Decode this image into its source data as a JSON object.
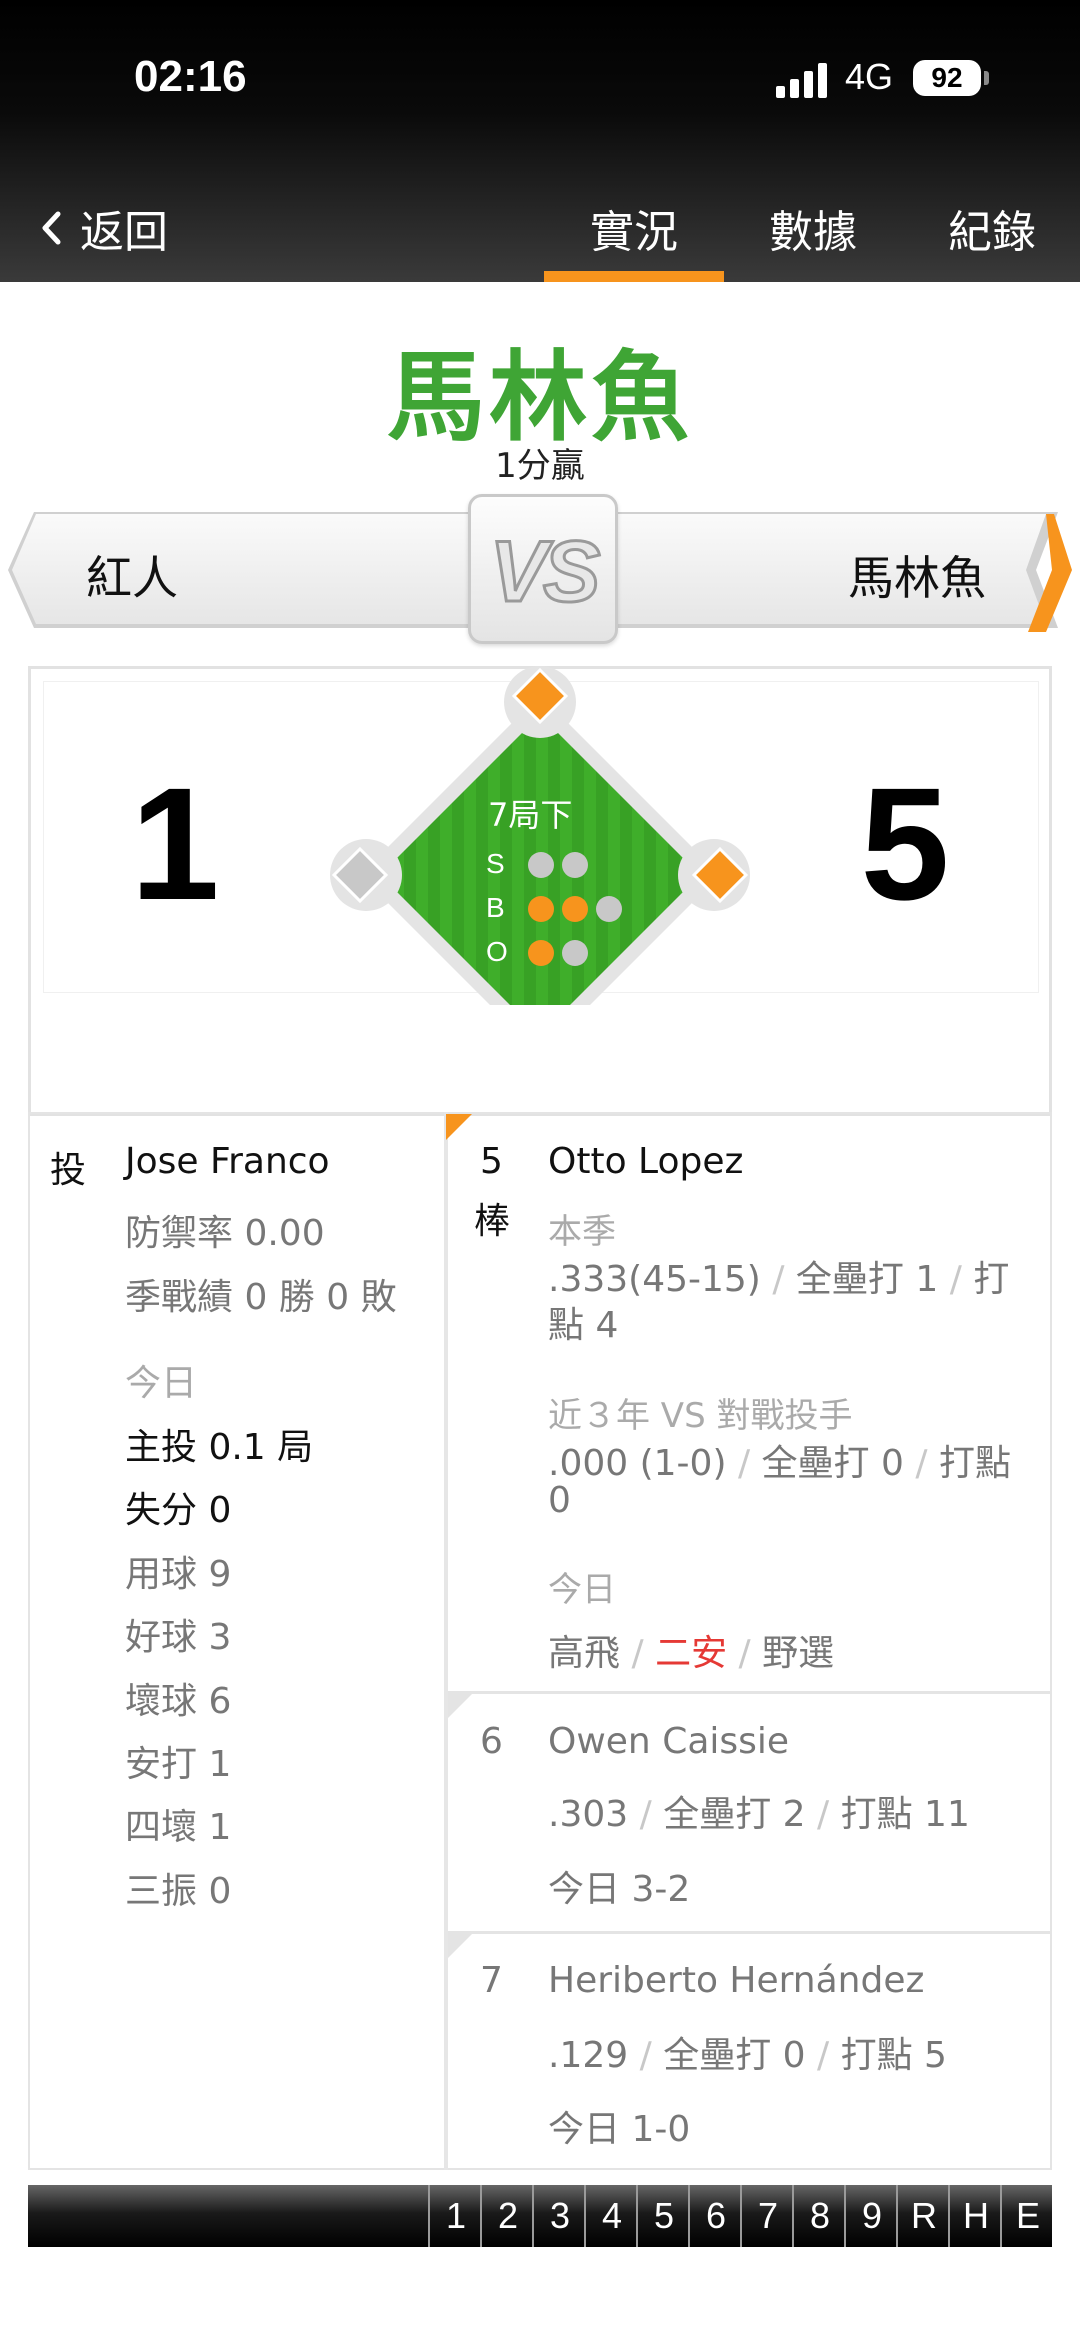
{
  "status_bar": {
    "time": "02:16",
    "network": "4G",
    "battery": "92"
  },
  "nav": {
    "back_label": "返回",
    "tabs": [
      {
        "label": "實況",
        "active": true
      },
      {
        "label": "數據",
        "active": false
      },
      {
        "label": "紀錄",
        "active": false
      }
    ]
  },
  "result": {
    "winner": "馬林魚",
    "margin": "1分贏"
  },
  "matchup": {
    "away_team": "紅人",
    "home_team": "馬林魚",
    "vs": "VS"
  },
  "score": {
    "away": "1",
    "home": "5"
  },
  "situation": {
    "inning": "7局下",
    "strikes_label": "S",
    "balls_label": "B",
    "outs_label": "O",
    "strikes": 0,
    "strike_slots": 2,
    "balls": 2,
    "ball_slots": 3,
    "outs": 1,
    "out_slots": 2,
    "bases": {
      "first": true,
      "second": true,
      "third": false
    },
    "colors": {
      "active": "#f7941d",
      "inactive": "#c8c8c8",
      "field": "#3fae2a"
    }
  },
  "pitcher": {
    "role_label": "投",
    "name": "Jose Franco",
    "era": "防禦率 0.00",
    "record": "季戰績 0 勝 0 敗",
    "today_label": "今日",
    "innings": "主投 0.1 局",
    "runs": "失分 0",
    "pitches": "用球 9",
    "strikes": "好球 3",
    "balls": "壞球 6",
    "hits": "安打 1",
    "walks": "四壞 1",
    "strikeouts": "三振 0"
  },
  "batters": [
    {
      "order": "5",
      "order_suffix": "棒",
      "name": "Otto Lopez",
      "season_label": "本季",
      "season_avg": ".333(45-15)",
      "season_hr": "全壘打 1",
      "season_rbi_1": "打",
      "season_rbi_2": "點 4",
      "vs_label": "近３年 VS 對戰投手",
      "vs_avg": ".000 (1-0)",
      "vs_hr": "全壘打 0",
      "vs_rbi_1": "打點",
      "vs_rbi_2": "0",
      "today_label": "今日",
      "today": [
        "高飛",
        "二安",
        "野選"
      ]
    },
    {
      "order": "6",
      "name": "Owen Caissie",
      "avg": ".303",
      "hr": "全壘打 2",
      "rbi": "打點 11",
      "today": "今日 3-2"
    },
    {
      "order": "7",
      "name": "Heriberto Hernández",
      "avg": ".129",
      "hr": "全壘打 0",
      "rbi": "打點 5",
      "today": "今日 1-0"
    }
  ],
  "separator": "/",
  "linescore_headers": [
    "1",
    "2",
    "3",
    "4",
    "5",
    "6",
    "7",
    "8",
    "9",
    "R",
    "H",
    "E"
  ]
}
